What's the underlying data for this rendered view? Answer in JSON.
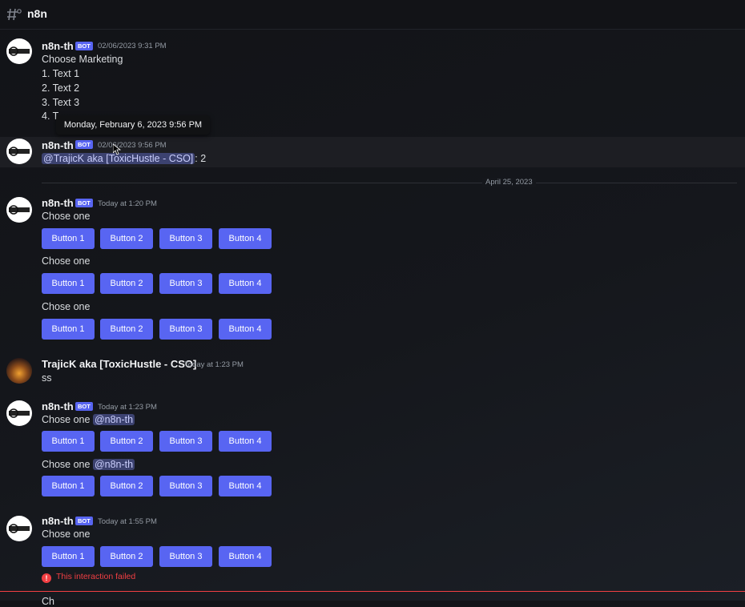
{
  "channel": {
    "name": "n8n"
  },
  "messages": [
    {
      "username": "n8n-th",
      "bot_tag": "BOT",
      "timestamp": "02/06/2023 9:31 PM",
      "lines": [
        "Choose Marketing",
        "1. Text 1",
        "2. Text 2",
        "3. Text 3",
        "4. T"
      ]
    },
    {
      "username": "n8n-th",
      "bot_tag": "BOT",
      "timestamp": "02/06/2023 9:56 PM",
      "mention": "@TrajicK aka [ToxicHustle - CSO]",
      "suffix": ": 2"
    },
    {
      "username": "n8n-th",
      "bot_tag": "BOT",
      "timestamp": "Today at 1:20 PM",
      "blocks": [
        {
          "text": "Chose one",
          "buttons": [
            "Button 1",
            "Button 2",
            "Button 3",
            "Button 4"
          ]
        },
        {
          "text": "Chose one",
          "buttons": [
            "Button 1",
            "Button 2",
            "Button 3",
            "Button 4"
          ]
        },
        {
          "text": "Chose one",
          "buttons": [
            "Button 1",
            "Button 2",
            "Button 3",
            "Button 4"
          ]
        }
      ]
    },
    {
      "username": "TrajicK aka [ToxicHustle - CSO]",
      "timestamp": "Today at 1:23 PM",
      "lines": [
        "ss"
      ]
    },
    {
      "username": "n8n-th",
      "bot_tag": "BOT",
      "timestamp": "Today at 1:23 PM",
      "blocks": [
        {
          "text": "Chose one",
          "mention": "@n8n-th",
          "buttons": [
            "Button 1",
            "Button 2",
            "Button 3",
            "Button 4"
          ]
        },
        {
          "text": "Chose one",
          "mention": "@n8n-th",
          "buttons": [
            "Button 1",
            "Button 2",
            "Button 3",
            "Button 4"
          ]
        }
      ]
    },
    {
      "username": "n8n-th",
      "bot_tag": "BOT",
      "timestamp": "Today at 1:55 PM",
      "blocks": [
        {
          "text": "Chose one",
          "buttons": [
            "Button 1",
            "Button 2",
            "Button 3",
            "Button 4"
          ]
        }
      ],
      "error": "This interaction failed"
    }
  ],
  "tooltip": "Monday, February 6, 2023 9:56 PM",
  "date_divider": "April 25, 2023",
  "cut_off_text": "Ch",
  "colors": {
    "accent": "#5865f2",
    "error": "#f23f43",
    "mention_bg": "#3c4270"
  },
  "icons": {
    "channel": "hash-thread-icon",
    "error": "error-icon"
  }
}
